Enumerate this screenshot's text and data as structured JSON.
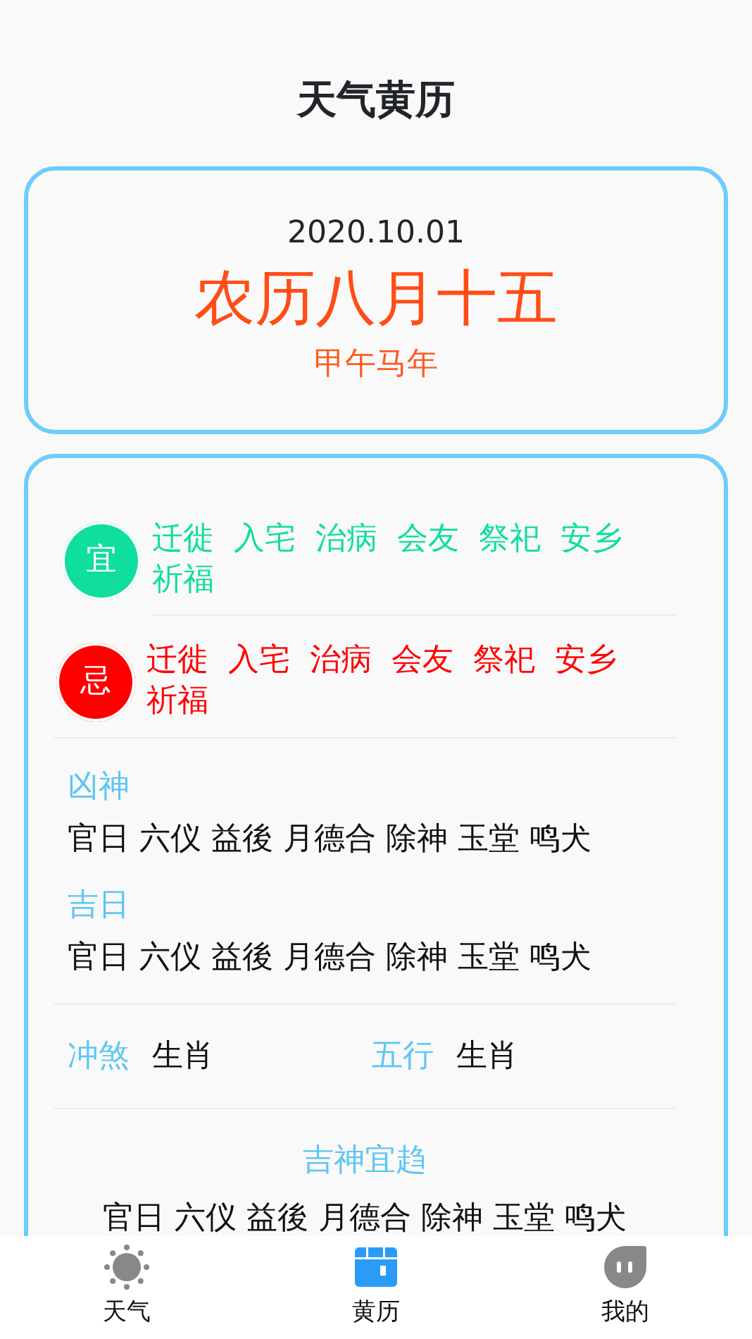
{
  "title": "天气黄历",
  "date_card": {
    "date": "2020.10.01",
    "lunar": "农历八月十五",
    "year": "甲午马年"
  },
  "almanac": {
    "verdicts": [
      {
        "kind": "good",
        "badge": "宜",
        "items": [
          "迁徙",
          "入宅",
          "治病",
          "会友",
          "祭祀",
          "安乡",
          "祈福"
        ]
      },
      {
        "kind": "bad",
        "badge": "忌",
        "items": [
          "迁徙",
          "入宅",
          "治病",
          "会友",
          "祭祀",
          "安乡",
          "祈福"
        ]
      }
    ],
    "sections": [
      {
        "label": "凶神",
        "text": "官日 六仪 益後 月德合 除神 玉堂 鸣犬"
      },
      {
        "label": "吉日",
        "text": "官日 六仪 益後 月德合 除神 玉堂 鸣犬"
      }
    ],
    "pairs": [
      {
        "label": "冲煞",
        "value": "生肖"
      },
      {
        "label": "五行",
        "value": "生肖"
      }
    ],
    "footer": {
      "label": "吉神宜趋",
      "text": "官日 六仪 益後 月德合 除神 玉堂 鸣犬"
    }
  },
  "tabs": [
    {
      "label": "天气",
      "kind": "weather",
      "selected": false
    },
    {
      "label": "黄历",
      "kind": "almanac",
      "selected": true
    },
    {
      "label": "我的",
      "kind": "profile",
      "selected": false
    }
  ]
}
